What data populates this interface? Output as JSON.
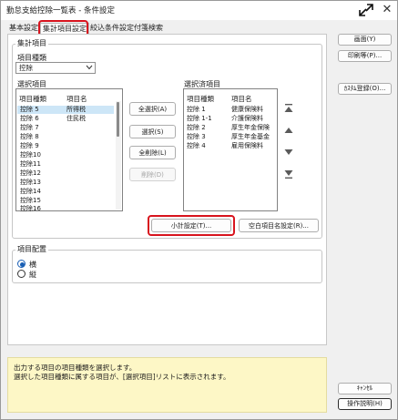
{
  "window": {
    "title": "勤怠支給控除一覧表 - 条件設定"
  },
  "tabs": [
    {
      "label": "基本設定",
      "active": false
    },
    {
      "label": "集計項目設定",
      "active": true
    },
    {
      "label": "絞込条件設定",
      "active": false
    },
    {
      "label": "付箋検索",
      "active": false
    }
  ],
  "summary_group": {
    "label": "集計項目",
    "item_type_label": "項目種類",
    "item_type_value": "控除"
  },
  "available_list": {
    "label": "選択項目",
    "columns": [
      "項目種類",
      "項目名"
    ],
    "rows": [
      {
        "type": "控除 5",
        "name": "所得税",
        "selected": true
      },
      {
        "type": "控除 6",
        "name": "住民税",
        "selected": false
      },
      {
        "type": "控除 7",
        "name": "",
        "selected": false
      },
      {
        "type": "控除 8",
        "name": "",
        "selected": false
      },
      {
        "type": "控除 9",
        "name": "",
        "selected": false
      },
      {
        "type": "控除10",
        "name": "",
        "selected": false
      },
      {
        "type": "控除11",
        "name": "",
        "selected": false
      },
      {
        "type": "控除12",
        "name": "",
        "selected": false
      },
      {
        "type": "控除13",
        "name": "",
        "selected": false
      },
      {
        "type": "控除14",
        "name": "",
        "selected": false
      },
      {
        "type": "控除15",
        "name": "",
        "selected": false
      },
      {
        "type": "控除16",
        "name": "",
        "selected": false
      }
    ]
  },
  "selected_list": {
    "label": "選択済項目",
    "columns": [
      "項目種類",
      "項目名"
    ],
    "rows": [
      {
        "type": "控除 1",
        "name": "健康保険料"
      },
      {
        "type": "控除 1-1",
        "name": "介護保険料"
      },
      {
        "type": "控除 2",
        "name": "厚生年金保険"
      },
      {
        "type": "控除 3",
        "name": "厚生年金基金"
      },
      {
        "type": "控除 4",
        "name": "雇用保険料"
      }
    ]
  },
  "middle_buttons": {
    "select_all": "全選択(A)",
    "select": "選択(S)",
    "remove_all": "全削除(L)",
    "remove": "削除(D)"
  },
  "bottom_buttons": {
    "subtotal": "小計設定(T)...",
    "blank_item": "空白項目名設定(R)..."
  },
  "layout_group": {
    "label": "項目配置",
    "options": [
      {
        "label": "横",
        "checked": true
      },
      {
        "label": "縦",
        "checked": false
      }
    ]
  },
  "hint": {
    "line1": "出力する項目の項目種類を選択します。",
    "line2": "選択した項目種類に属する項目が、[選択項目]リストに表示されます。"
  },
  "side_buttons": {
    "screen": "画面(Y)",
    "print": "印刷等(P)...",
    "register": "ｶｽﾀﾑ登録(O)...",
    "cancel": "ｷｬﾝｾﾙ",
    "help": "操作説明(H)"
  },
  "icons": {
    "order_top": "move-top-icon",
    "order_up": "move-up-icon",
    "order_down": "move-down-icon",
    "order_bottom": "move-bottom-icon"
  },
  "colors": {
    "highlight_box": "#d8141e",
    "hint_background": "#fdf7c6",
    "row_selection": "#cde6f7"
  }
}
